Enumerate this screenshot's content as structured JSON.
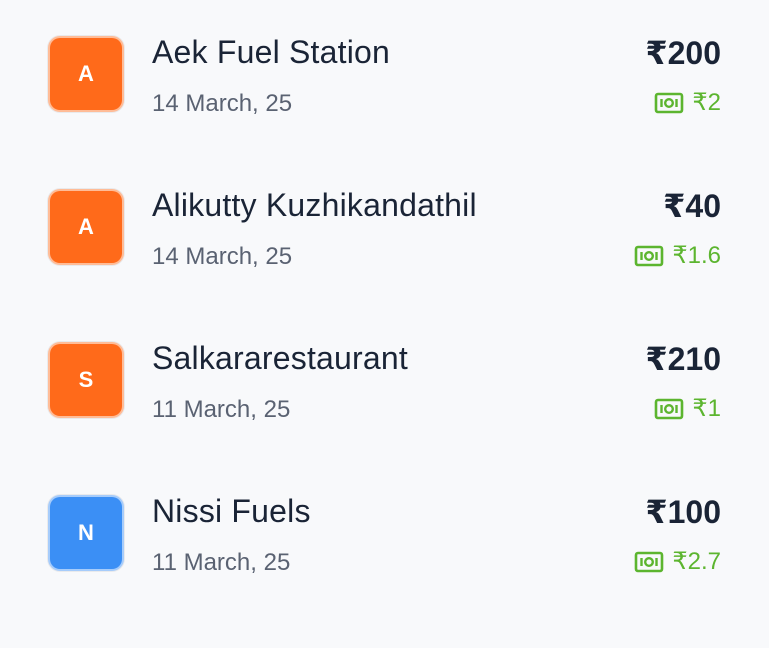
{
  "colors": {
    "orange_avatar": "#ff6a1a",
    "blue_avatar": "#3b8ff5",
    "cashback_green": "#5cb52f",
    "text_primary": "#1a2436",
    "text_secondary": "#5a6272",
    "background": "#f8f9fb"
  },
  "cashback_icon": "cash-note-icon",
  "transactions": [
    {
      "initial": "A",
      "avatar_color": "#ff6a1a",
      "name": "Aek Fuel Station",
      "date": "14 March, 25",
      "amount": "₹200",
      "cashback": "₹2"
    },
    {
      "initial": "A",
      "avatar_color": "#ff6a1a",
      "name": "Alikutty Kuzhikandathil",
      "date": "14 March, 25",
      "amount": "₹40",
      "cashback": "₹1.6"
    },
    {
      "initial": "S",
      "avatar_color": "#ff6a1a",
      "name": "Salkararestaurant",
      "date": "11 March, 25",
      "amount": "₹210",
      "cashback": "₹1"
    },
    {
      "initial": "N",
      "avatar_color": "#3b8ff5",
      "name": "Nissi Fuels",
      "date": "11 March, 25",
      "amount": "₹100",
      "cashback": "₹2.7"
    }
  ]
}
